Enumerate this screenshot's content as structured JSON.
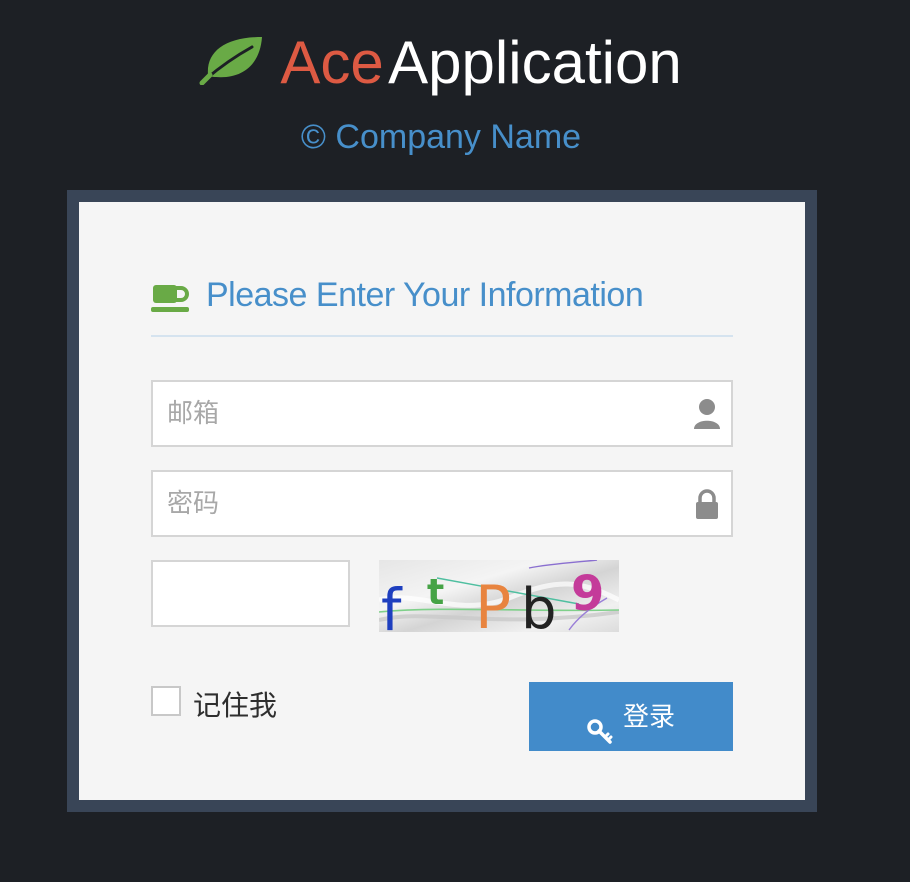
{
  "brand": {
    "title_accent": "Ace",
    "title_main": "Application",
    "company": "© Company Name",
    "logo_icon": "leaf-icon",
    "colors": {
      "accent": "#dd5a43",
      "leaf": "#69aa46",
      "link": "#478fca",
      "background": "#1d2025"
    }
  },
  "login": {
    "heading": "Please Enter Your Information",
    "heading_icon": "coffee-icon",
    "email": {
      "placeholder": "邮箱",
      "value": "",
      "icon": "user-icon"
    },
    "password": {
      "placeholder": "密码",
      "value": "",
      "icon": "lock-icon"
    },
    "captcha": {
      "value": "",
      "image_text": "ftPb9"
    },
    "remember_label": "记住我",
    "remember_checked": false,
    "submit_label": "登录",
    "submit_icon": "key-icon",
    "button_color": "#428bca"
  }
}
